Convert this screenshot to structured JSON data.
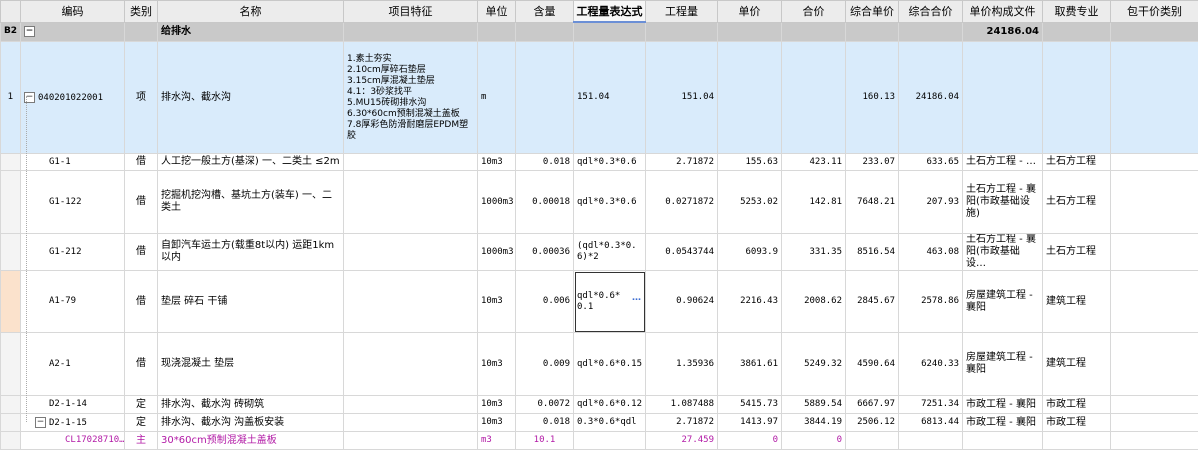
{
  "columns": [
    "编码",
    "类别",
    "名称",
    "项目特征",
    "单位",
    "含量",
    "工程量表达式",
    "工程量",
    "单价",
    "合价",
    "综合单价",
    "综合合价",
    "单价构成文件",
    "取费专业",
    "包干价类别"
  ],
  "group": {
    "rowhdr": "B2",
    "toggle": "−",
    "name": "给排水",
    "total": "24186.04"
  },
  "main_row": {
    "index": "1",
    "toggle": "−",
    "code": "040201022001",
    "cat": "项",
    "name": "排水沟、截水沟",
    "features": [
      "1.素土夯实",
      "2.10cm厚碎石垫层",
      "3.15cm厚混凝土垫层",
      "4.1：3砂浆找平",
      "5.MU15砖砌排水沟",
      "6.30*60cm预制混凝土盖板",
      "7.8厚彩色防滑耐磨层EPDM塑胶"
    ],
    "unit": "m",
    "expr": "151.04",
    "qty": "151.04",
    "comp_price": "160.13",
    "comp_total": "24186.04"
  },
  "sub_rows": [
    {
      "code": "G1-1",
      "cat": "借",
      "name": "人工挖一般土方(基深) 一、二类土 ≤2m",
      "unit": "10m3",
      "content": "0.018",
      "expr": "qdl*0.3*0.6",
      "qty": "2.71872",
      "price": "155.63",
      "total": "423.11",
      "comp_price": "233.07",
      "comp_total": "633.65",
      "file": "土石方工程 - …",
      "major": "土石方工程"
    },
    {
      "code": "G1-122",
      "cat": "借",
      "name": "挖掘机挖沟槽、基坑土方(装车) 一、二类土",
      "unit": "1000m3",
      "content": "0.00018",
      "expr": "qdl*0.3*0.6",
      "qty": "0.0271872",
      "price": "5253.02",
      "total": "142.81",
      "comp_price": "7648.21",
      "comp_total": "207.93",
      "file": "土石方工程 - 襄阳(市政基础设施)",
      "major": "土石方工程"
    },
    {
      "code": "G1-212",
      "cat": "借",
      "name": "自卸汽车运土方(载重8t以内) 运距1km以内",
      "unit": "1000m3",
      "content": "0.00036",
      "expr": "(qdl*0.3*0.6)*2",
      "qty": "0.0543744",
      "price": "6093.9",
      "total": "331.35",
      "comp_price": "8516.54",
      "comp_total": "463.08",
      "file": "土石方工程 - 襄阳(市政基础设…",
      "major": "土石方工程"
    },
    {
      "code": "A1-79",
      "cat": "借",
      "name": "垫层 碎石 干铺",
      "unit": "10m3",
      "content": "0.006",
      "expr": "qdl*0.6*0.1",
      "qty": "0.90624",
      "price": "2216.43",
      "total": "2008.62",
      "comp_price": "2845.67",
      "comp_total": "2578.86",
      "file": "房屋建筑工程 - 襄阳",
      "major": "建筑工程"
    },
    {
      "code": "A2-1",
      "cat": "借",
      "name": "现浇混凝土 垫层",
      "unit": "10m3",
      "content": "0.009",
      "expr": "qdl*0.6*0.15",
      "qty": "1.35936",
      "price": "3861.61",
      "total": "5249.32",
      "comp_price": "4590.64",
      "comp_total": "6240.33",
      "file": "房屋建筑工程 - 襄阳",
      "major": "建筑工程"
    },
    {
      "code": "D2-1-14",
      "cat": "定",
      "name": "排水沟、截水沟 砖砌筑",
      "unit": "10m3",
      "content": "0.0072",
      "expr": "qdl*0.6*0.12",
      "qty": "1.087488",
      "price": "5415.73",
      "total": "5889.54",
      "comp_price": "6667.97",
      "comp_total": "7251.34",
      "file": "市政工程 - 襄阳",
      "major": "市政工程"
    },
    {
      "code": "D2-1-15",
      "cat": "定",
      "name": "排水沟、截水沟 沟盖板安装",
      "unit": "10m3",
      "content": "0.018",
      "expr": "0.3*0.6*qdl",
      "qty": "2.71872",
      "price": "1413.97",
      "total": "3844.19",
      "comp_price": "2506.12",
      "comp_total": "6813.44",
      "file": "市政工程 - 襄阳",
      "major": "市政工程",
      "toggle": "−"
    }
  ],
  "material_row": {
    "code": "CL17028710…",
    "cat": "主",
    "name": "30*60cm预制混凝土盖板",
    "unit": "m3",
    "content": "10.1",
    "qty": "27.459",
    "price": "0",
    "total": "0"
  },
  "edit_dots": "…"
}
